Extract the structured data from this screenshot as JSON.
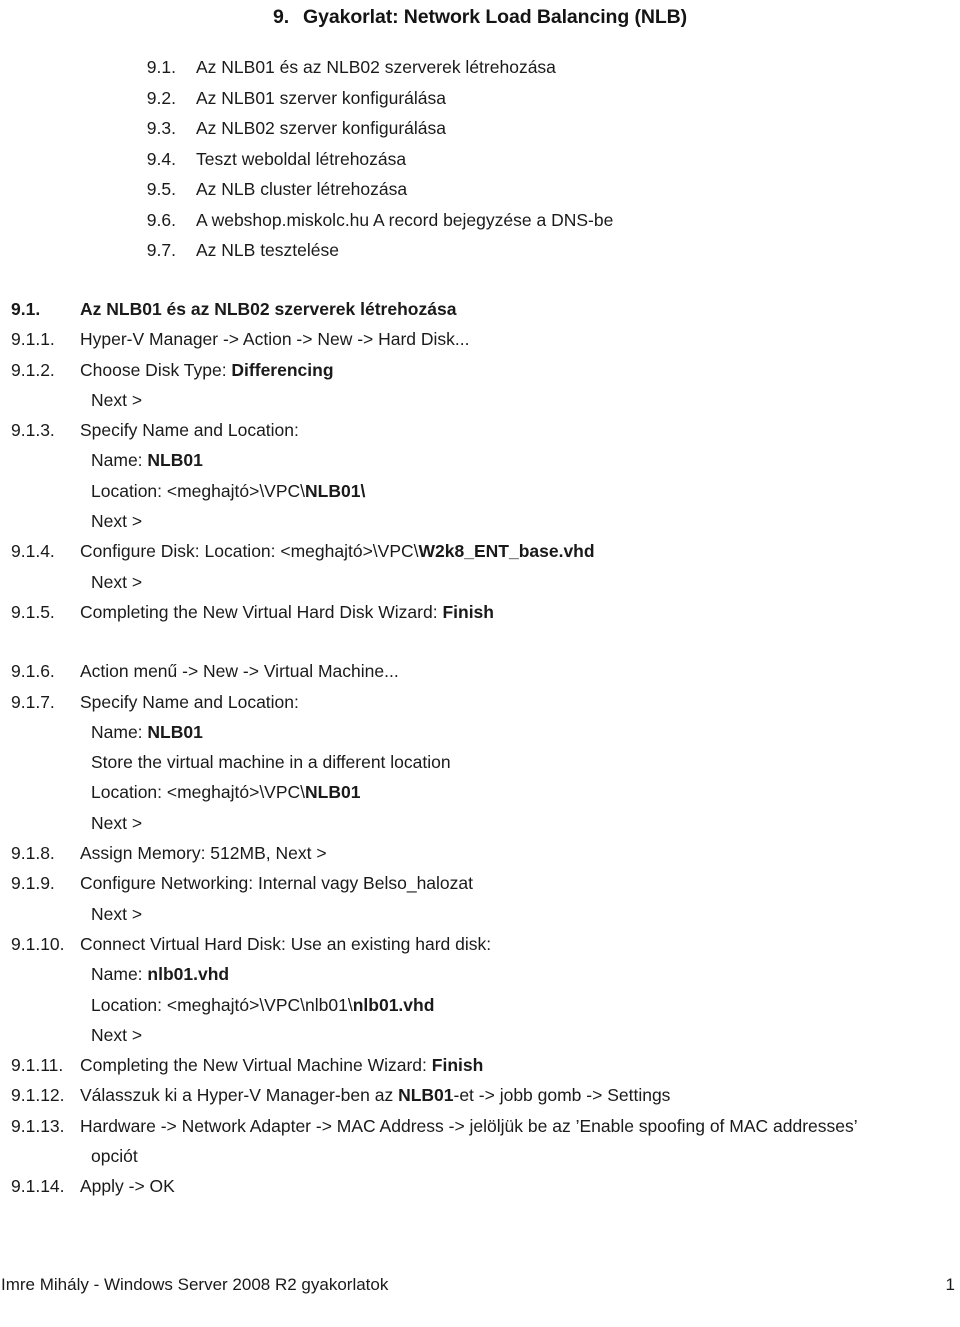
{
  "document": {
    "title_number": "9.",
    "title_text": "Gyakorlat: Network Load Balancing (NLB)"
  },
  "toc": {
    "items": [
      {
        "num": "9.1.",
        "text": "Az NLB01 és az NLB02 szerverek létrehozása"
      },
      {
        "num": "9.2.",
        "text": "Az NLB01 szerver konfigurálása"
      },
      {
        "num": "9.3.",
        "text": "Az NLB02 szerver konfigurálása"
      },
      {
        "num": "9.4.",
        "text": "Teszt weboldal létrehozása"
      },
      {
        "num": "9.5.",
        "text": "Az NLB cluster létrehozása"
      },
      {
        "num": "9.6.",
        "text": "A webshop.miskolc.hu A record bejegyzése a DNS-be"
      },
      {
        "num": "9.7.",
        "text": "Az NLB tesztelése"
      }
    ]
  },
  "section": {
    "heading": {
      "num": "9.1.",
      "text": "Az NLB01 és az NLB02 szerverek létrehozása"
    },
    "steps": {
      "s1": {
        "num": "9.1.1.",
        "text": "Hyper-V Manager -> Action -> New -> Hard Disk..."
      },
      "s2": {
        "num": "9.1.2.",
        "lead": "Choose Disk Type: ",
        "strong": "Differencing",
        "next": "Next >"
      },
      "s3": {
        "num": "9.1.3.",
        "text": "Specify Name and Location:",
        "name_lead": "Name: ",
        "name_strong": "NLB01",
        "loc_lead": "Location: <meghajtó>\\VPC\\",
        "loc_strong": "NLB01\\",
        "next": "Next >"
      },
      "s4": {
        "num": "9.1.4.",
        "lead": "Configure Disk: Location: <meghajtó>\\VPC\\",
        "strong": "W2k8_ENT_base.vhd",
        "next": "Next >"
      },
      "s5": {
        "num": "9.1.5.",
        "lead": "Completing the New Virtual Hard Disk Wizard: ",
        "strong": "Finish"
      },
      "s6": {
        "num": "9.1.6.",
        "text": "Action menű -> New ->  Virtual Machine..."
      },
      "s7": {
        "num": "9.1.7.",
        "text": "Specify Name and Location:",
        "name_lead": "Name: ",
        "name_strong": "NLB01",
        "store": "Store the virtual machine in a different location",
        "loc_lead": "Location: <meghajtó>\\VPC\\",
        "loc_strong": "NLB01",
        "next": "Next >"
      },
      "s8": {
        "num": "9.1.8.",
        "text": "Assign Memory: 512MB, Next >"
      },
      "s9": {
        "num": "9.1.9.",
        "text": "Configure Networking: Internal vagy Belso_halozat",
        "next": "Next >"
      },
      "s10": {
        "num": "9.1.10.",
        "text": "Connect Virtual Hard Disk: Use an existing hard disk:",
        "name_lead": "Name: ",
        "name_strong": "nlb01.vhd",
        "loc_lead": "Location: <meghajtó>\\VPC\\nlb01\\",
        "loc_strong": "nlb01.vhd",
        "next": "Next >"
      },
      "s11": {
        "num": "9.1.11.",
        "lead": "Completing the New Virtual Machine Wizard: ",
        "strong": "Finish"
      },
      "s12": {
        "num": "9.1.12.",
        "lead": "Válasszuk ki a Hyper-V Manager-ben az ",
        "strong": "NLB01",
        "tail": "-et -> jobb gomb -> Settings"
      },
      "s13": {
        "num": "9.1.13.",
        "text": "Hardware -> Network Adapter -> MAC Address -> jelöljük be az ’Enable spoofing of MAC addresses’",
        "cont": "opciót"
      },
      "s14": {
        "num": "9.1.14.",
        "text": "Apply -> OK"
      }
    }
  },
  "footer": {
    "left": "Imre Mihály - Windows Server 2008 R2 gyakorlatok",
    "page_number": "1"
  }
}
